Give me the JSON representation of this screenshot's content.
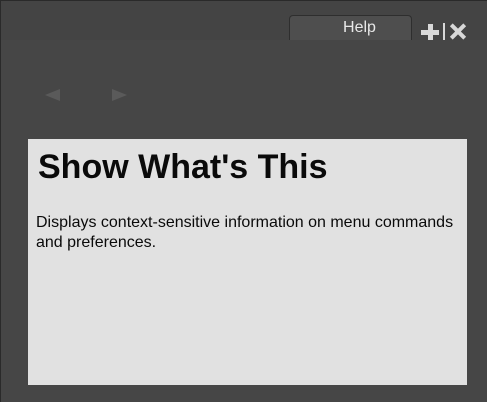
{
  "tab": {
    "label": "Help",
    "actions": {
      "add_icon": "plus-icon",
      "close_icon": "close-icon"
    }
  },
  "navigation": {
    "back_icon": "back-arrow-icon",
    "forward_icon": "forward-arrow-icon"
  },
  "content": {
    "title": "Show What's This",
    "description": "Displays context-sensitive information on menu commands and preferences."
  },
  "colors": {
    "panel_background": "#464646",
    "content_background": "#e1e1e1",
    "tab_background": "#4e4e4e",
    "icon_color": "#d8d8d8"
  }
}
